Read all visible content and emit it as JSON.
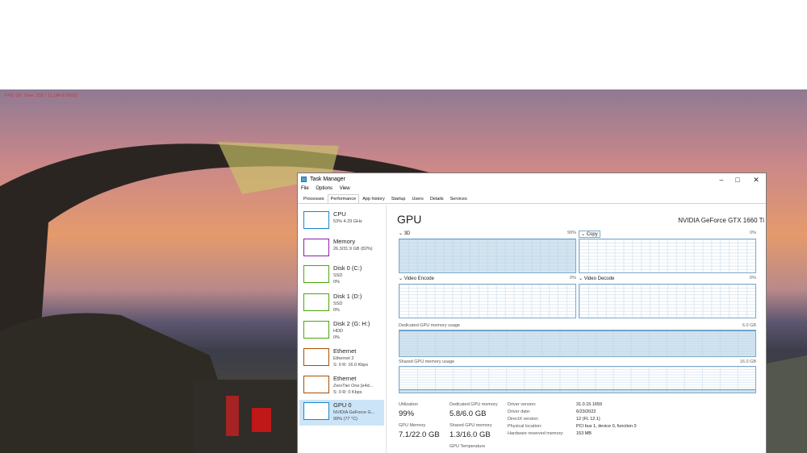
{
  "background": {
    "osd_text": "FPS: 28, Time: 235 / 11 (MI-8 0000)"
  },
  "window": {
    "title": "Task Manager",
    "menu": [
      "File",
      "Options",
      "View"
    ],
    "tabs": [
      "Processes",
      "Performance",
      "App history",
      "Startup",
      "Users",
      "Details",
      "Services"
    ],
    "active_tab": "Performance"
  },
  "sidebar": {
    "items": [
      {
        "title": "CPU",
        "sub1": "53%  4.29 GHz",
        "sub2": "",
        "color": "#1a87c9"
      },
      {
        "title": "Memory",
        "sub1": "26.3/31.9 GB (82%)",
        "sub2": "",
        "color": "#8b1fa9"
      },
      {
        "title": "Disk 0 (C:)",
        "sub1": "SSD",
        "sub2": "0%",
        "color": "#4da60c"
      },
      {
        "title": "Disk 1 (D:)",
        "sub1": "SSD",
        "sub2": "0%",
        "color": "#4da60c"
      },
      {
        "title": "Disk 2 (G: H:)",
        "sub1": "HDD",
        "sub2": "0%",
        "color": "#4da60c"
      },
      {
        "title": "Ethernet",
        "sub1": "Ethernet 2",
        "sub2": "S: 0  R: 16.0 Kbps",
        "color": "#a74f01"
      },
      {
        "title": "Ethernet",
        "sub1": "ZeroTier One [e4d...",
        "sub2": "S: 0  R: 0 Kbps",
        "color": "#a74f01"
      },
      {
        "title": "GPU 0",
        "sub1": "NVIDIA GeForce G...",
        "sub2": "99%  (77 °C)",
        "color": "#1a87c9"
      }
    ]
  },
  "gpu": {
    "title": "GPU",
    "model": "NVIDIA GeForce GTX 1660 Ti",
    "engines": [
      {
        "label": "3D",
        "pct": "99%",
        "level": 0.99
      },
      {
        "label": "Copy",
        "pct": "0%",
        "level": 0.0
      },
      {
        "label": "Video Encode",
        "pct": "0%",
        "level": 0.0
      },
      {
        "label": "Video Decode",
        "pct": "0%",
        "level": 0.0
      }
    ],
    "dedicated": {
      "label": "Dedicated GPU memory usage",
      "max": "6.0 GB",
      "level": 0.97
    },
    "shared": {
      "label": "Shared GPU memory usage",
      "max": "16.0 GB",
      "level": 0.08
    },
    "stats": {
      "utilization_label": "Utilization",
      "utilization": "99%",
      "dedicated_label": "Dedicated GPU memory",
      "dedicated": "5.8/6.0 GB",
      "gpu_memory_label": "GPU Memory",
      "gpu_memory": "7.1/22.0 GB",
      "shared_label": "Shared GPU memory",
      "shared": "1.3/16.0 GB",
      "temp_label": "GPU Temperature"
    },
    "info": [
      {
        "k": "Driver version:",
        "v": "31.0.15.1659"
      },
      {
        "k": "Driver date:",
        "v": "6/23/2022"
      },
      {
        "k": "DirectX version:",
        "v": "12 (FL 12.1)"
      },
      {
        "k": "Physical location:",
        "v": "PCI bus 1, device 0, function 0"
      },
      {
        "k": "Hardware reserved memory:",
        "v": "153 MB"
      }
    ]
  }
}
